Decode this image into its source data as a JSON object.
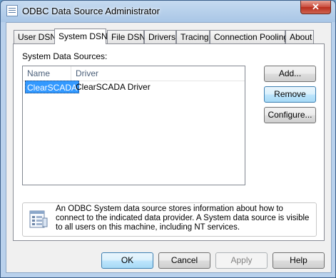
{
  "window": {
    "title": "ODBC Data Source Administrator",
    "close_label": "✕"
  },
  "tabs": [
    {
      "label": "User DSN",
      "active": false
    },
    {
      "label": "System DSN",
      "active": true
    },
    {
      "label": "File DSN",
      "active": false
    },
    {
      "label": "Drivers",
      "active": false
    },
    {
      "label": "Tracing",
      "active": false
    },
    {
      "label": "Connection Pooling",
      "active": false
    },
    {
      "label": "About",
      "active": false
    }
  ],
  "panel": {
    "label": "System Data Sources:",
    "columns": [
      "Name",
      "Driver"
    ],
    "rows": [
      {
        "name": "ClearSCADA",
        "driver": "ClearSCADA Driver",
        "selected": true
      }
    ],
    "buttons": {
      "add": "Add...",
      "remove": "Remove",
      "configure": "Configure..."
    },
    "info": {
      "text": "An ODBC System data source stores information about how to connect to the indicated data provider.   A System data source is visible to all users on this machine, including NT services.",
      "icon": "database-info-icon"
    }
  },
  "footer": {
    "ok": "OK",
    "cancel": "Cancel",
    "apply": "Apply",
    "help": "Help"
  },
  "colors": {
    "selection": "#3399ff",
    "title_bar": "#a9c6e6",
    "close_button": "#c8493a"
  }
}
